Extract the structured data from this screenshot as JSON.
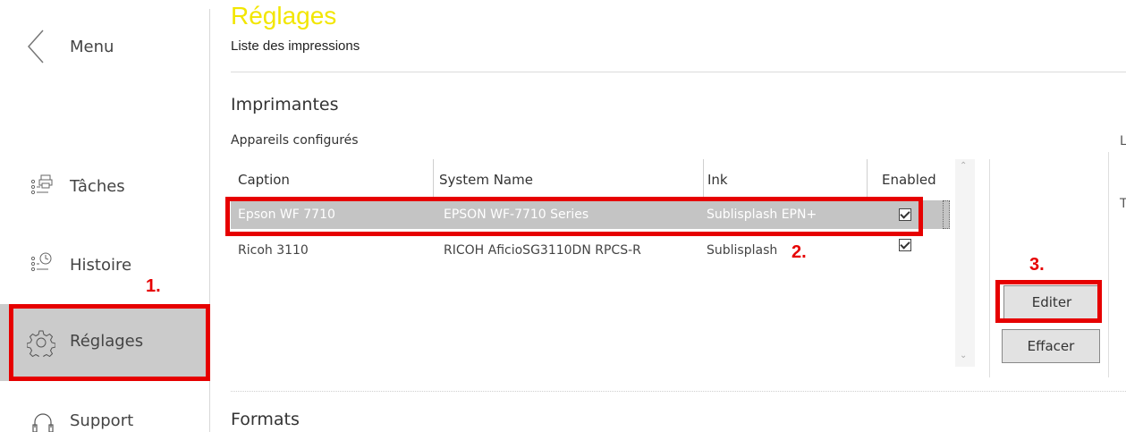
{
  "sidebar": {
    "menu_label": "Menu",
    "items": [
      {
        "label": "Tâches",
        "icon": "tasks-printer-icon"
      },
      {
        "label": "Histoire",
        "icon": "history-clock-icon"
      },
      {
        "label": "Réglages",
        "icon": "gear-icon"
      },
      {
        "label": "Support",
        "icon": "headset-icon"
      }
    ]
  },
  "header": {
    "title": "Réglages",
    "subtitle": "Liste des impressions"
  },
  "printers": {
    "section_title": "Imprimantes",
    "subtitle": "Appareils configurés",
    "columns": [
      "Caption",
      "System Name",
      "Ink",
      "Enabled"
    ],
    "rows": [
      {
        "caption": "Epson WF 7710",
        "system_name": "EPSON WF-7710 Series",
        "ink": "Sublisplash EPN+",
        "enabled": true
      },
      {
        "caption": "Ricoh 3110",
        "system_name": "RICOH AficioSG3110DN RPCS-R",
        "ink": "Sublisplash",
        "enabled": true
      }
    ],
    "edit_button": "Editer",
    "delete_button": "Effacer"
  },
  "formats": {
    "section_title": "Formats"
  },
  "annotations": {
    "step1": "1.",
    "step2": "2.",
    "step3": "3."
  },
  "right_edge_chars": [
    "L",
    "T"
  ],
  "colors": {
    "title_yellow": "#f2e600",
    "annotation_red": "#e60000",
    "active_bg": "#cbcbcb",
    "selected_row_bg": "#c4c4c4"
  }
}
